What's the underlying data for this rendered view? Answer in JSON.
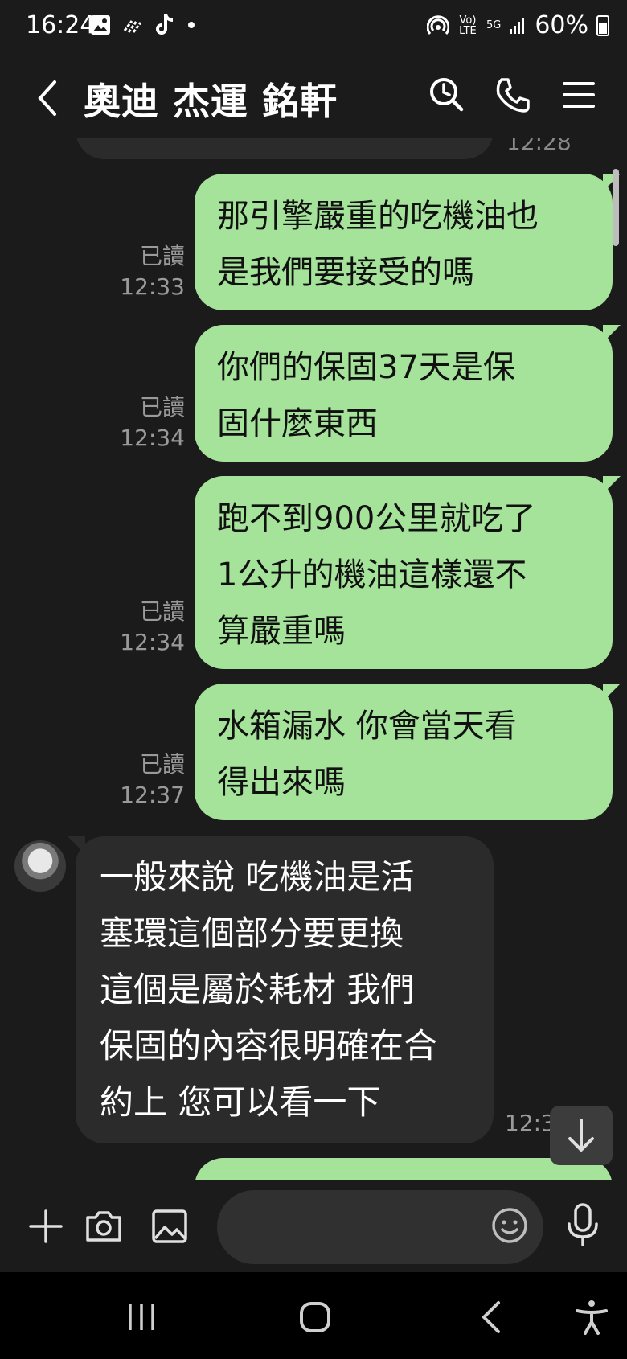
{
  "status_bar": {
    "time": "16:24",
    "left_icons": [
      "image-icon",
      "signal-waves-icon",
      "tiktok-icon",
      "dot-icon"
    ],
    "volte": "Vo) LTE",
    "network": "5G",
    "battery": "60%"
  },
  "header": {
    "title": "奧迪 杰運 銘軒",
    "icons": [
      "back-icon",
      "search-clock-icon",
      "phone-icon",
      "menu-icon"
    ]
  },
  "messages": {
    "prev_time": "12:28",
    "m1": {
      "lines": [
        "那引擎嚴重的吃機油也",
        "是我們要接受的嗎"
      ],
      "read": "已讀",
      "time": "12:33"
    },
    "m2": {
      "lines": [
        "你們的保固37天是保",
        "固什麼東西"
      ],
      "read": "已讀",
      "time": "12:34"
    },
    "m3": {
      "lines": [
        "跑不到900公里就吃了",
        "1公升的機油這樣還不",
        "算嚴重嗎"
      ],
      "read": "已讀",
      "time": "12:34"
    },
    "m4": {
      "lines": [
        "水箱漏水 你會當天看",
        "得出來嗎"
      ],
      "read": "已讀",
      "time": "12:37"
    },
    "m5": {
      "lines": [
        "一般來說 吃機油是活",
        "塞環這個部分要更換",
        "這個是屬於耗材 我們",
        "保固的內容很明確在合",
        "約上 您可以看一下"
      ],
      "time": "12:3"
    }
  },
  "input_bar": {
    "message_placeholder": "",
    "icons": [
      "plus-icon",
      "camera-icon",
      "gallery-icon",
      "emoji-icon",
      "mic-icon"
    ]
  },
  "colors": {
    "background": "#1b1b1b",
    "outgoing_bubble": "#a5e29a",
    "incoming_bubble": "#2b2b2b",
    "meta_text": "#9a9a9a"
  }
}
